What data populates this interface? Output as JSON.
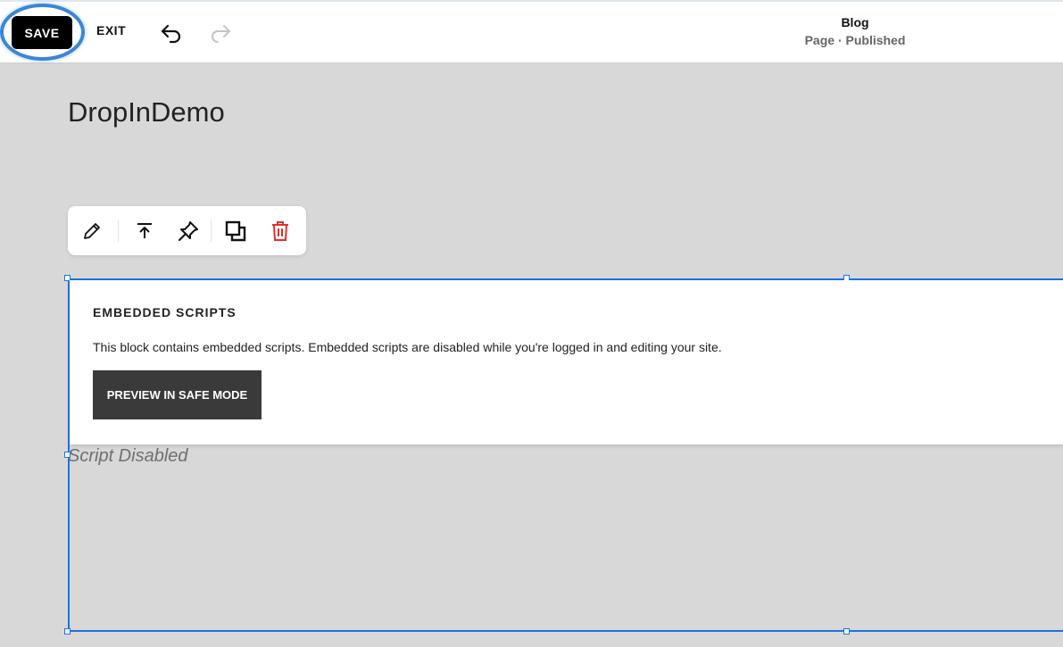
{
  "toolbar": {
    "save_label": "SAVE",
    "exit_label": "EXIT",
    "undo_icon": "undo-icon",
    "redo_icon": "redo-icon"
  },
  "page": {
    "name": "Blog",
    "status": "Page · Published"
  },
  "site": {
    "title": "DropInDemo"
  },
  "block_tools": [
    {
      "name": "edit",
      "icon": "pencil-icon"
    },
    {
      "name": "move-to-top",
      "icon": "arrow-up-to-line-icon"
    },
    {
      "name": "pin",
      "icon": "pin-icon"
    },
    {
      "name": "duplicate",
      "icon": "duplicate-icon"
    },
    {
      "name": "delete",
      "icon": "trash-icon"
    }
  ],
  "embed": {
    "heading": "EMBEDDED SCRIPTS",
    "text": "This block contains embedded scripts. Embedded scripts are disabled while you're logged in and editing your site.",
    "button_label": "PREVIEW IN SAFE MODE"
  },
  "placeholder": {
    "text": "Script Disabled"
  },
  "colors": {
    "accent": "#1a73e8",
    "highlight": "#3a86d6",
    "delete": "#e0312f",
    "canvas": "#d8d8d8"
  }
}
